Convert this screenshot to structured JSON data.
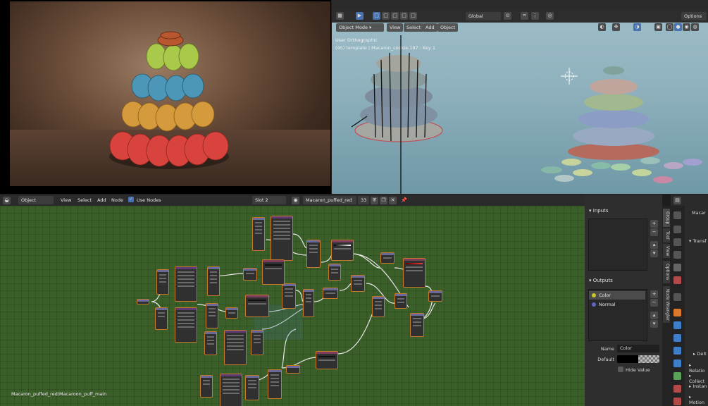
{
  "viewport": {
    "mode_menu": "Object Mode",
    "menus": [
      "View",
      "Select",
      "Add",
      "Object"
    ],
    "orientation": "Global",
    "options": "Options",
    "view_name": "User Orthographic",
    "object_info": "(45) template | Macaron_cookie.197 : Key 1"
  },
  "node_editor": {
    "editor_type": "Object",
    "menus": [
      "View",
      "Select",
      "Add",
      "Node"
    ],
    "use_nodes_label": "Use Nodes",
    "slot": "Slot 2",
    "material_name": "Macaron_puffed_red",
    "user_count": "33",
    "breadcrumb": "Macaron_puffed_red/Macaroon_puff_main"
  },
  "sidebar": {
    "inputs_title": "Inputs",
    "outputs_title": "Outputs",
    "outputs": [
      {
        "name": "Color",
        "color": "#c7c729",
        "selected": true
      },
      {
        "name": "Normal",
        "color": "#6363c7",
        "selected": false
      }
    ],
    "name_label": "Name",
    "name_value": "Color",
    "default_label": "Default",
    "hide_value_label": "Hide Value",
    "tabs": [
      "Group",
      "Tool",
      "View",
      "Options",
      "Node Wrangler"
    ]
  },
  "properties": {
    "header_text": "Macar",
    "section": "Transf",
    "items": [
      "Delt",
      "Relatio",
      "Collect",
      "Instan",
      "Motion"
    ]
  },
  "colors": {
    "node_canvas": "#3b5f28",
    "node_selected_outline": "#c8782a",
    "accent": "#4772b3"
  }
}
